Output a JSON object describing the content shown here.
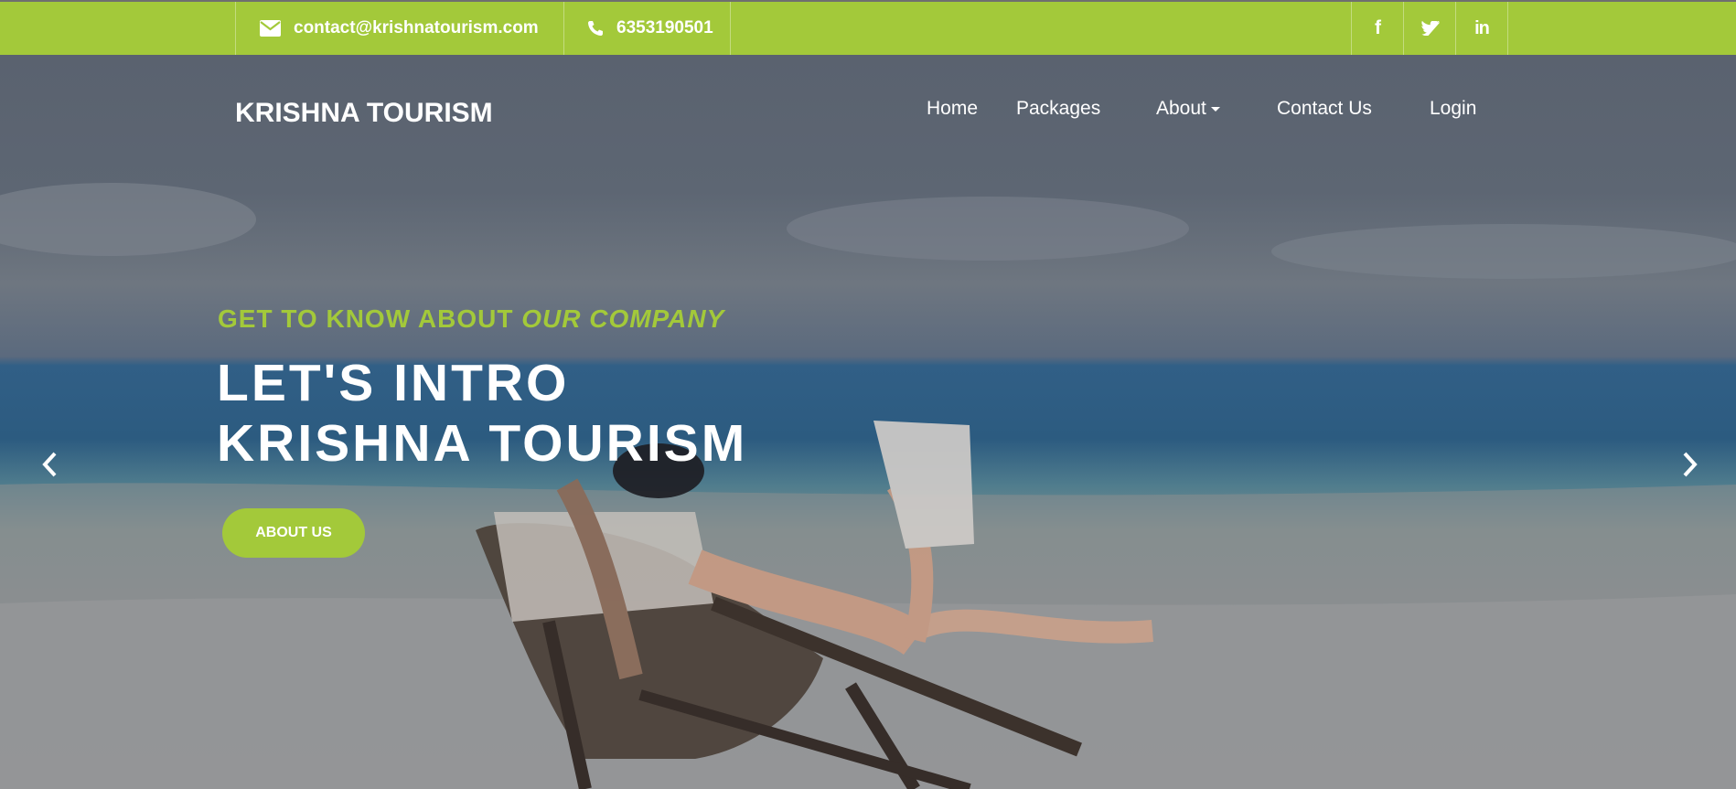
{
  "topbar": {
    "email": "contact@krishnatourism.com",
    "phone": "6353190501",
    "email_icon": "envelope-icon",
    "phone_icon": "phone-icon",
    "social": [
      {
        "name": "facebook",
        "icon": "facebook-icon",
        "label": "f"
      },
      {
        "name": "twitter",
        "icon": "twitter-icon"
      },
      {
        "name": "linkedin",
        "icon": "linkedin-icon",
        "label": "in"
      }
    ]
  },
  "nav": {
    "brand": "KRISHNA TOURISM",
    "items": [
      "Home",
      "Packages",
      "About",
      "Contact Us",
      "Login"
    ]
  },
  "hero": {
    "eyebrow_prefix": "GET TO KNOW ABOUT ",
    "eyebrow_emphasis": "OUR COMPANY",
    "headline_line1": "LET'S INTRO",
    "headline_line2": "KRISHNA TOURISM",
    "cta_label": "ABOUT US",
    "prev_icon": "chevron-left-icon",
    "next_icon": "chevron-right-icon"
  },
  "colors": {
    "accent": "#a3c93a",
    "overlay": "#56606e",
    "text": "#ffffff"
  }
}
